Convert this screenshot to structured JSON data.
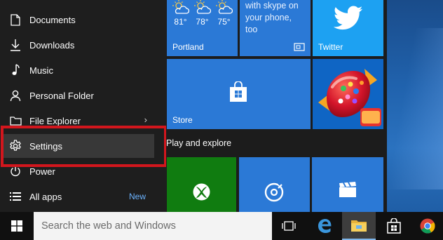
{
  "start_menu": {
    "items": [
      {
        "label": "Documents",
        "icon": "document-icon"
      },
      {
        "label": "Downloads",
        "icon": "download-icon"
      },
      {
        "label": "Music",
        "icon": "music-icon"
      },
      {
        "label": "Personal Folder",
        "icon": "person-icon"
      },
      {
        "label": "File Explorer",
        "icon": "folder-icon",
        "arrow": "›"
      },
      {
        "label": "Settings",
        "icon": "gear-icon",
        "selected": true
      },
      {
        "label": "Power",
        "icon": "power-icon"
      },
      {
        "label": "All apps",
        "icon": "list-icon",
        "badge": "New"
      }
    ]
  },
  "tiles": {
    "weather": {
      "label": "Portland",
      "temps": [
        "81°",
        "78°",
        "75°"
      ],
      "color": "#2b79d6"
    },
    "skype": {
      "text_lines": [
        "with skype on",
        "your phone,",
        "too"
      ],
      "color": "#2b79d6"
    },
    "twitter": {
      "label": "Twitter",
      "color": "#1da1f2"
    },
    "store": {
      "label": "Store",
      "color": "#2b79d6"
    },
    "candy_crush": {
      "color": "#0f65c4"
    },
    "section_title": "Play and explore",
    "xbox": {
      "color": "#107c10"
    },
    "groove": {
      "color": "#2b79d6"
    },
    "movies": {
      "color": "#2b79d6"
    }
  },
  "taskbar": {
    "search_placeholder": "Search the web and Windows",
    "apps": [
      "task-view-icon",
      "edge-icon",
      "file-explorer-icon",
      "store-icon",
      "chrome-icon"
    ]
  },
  "accent_colors": {
    "highlight_border": "#d2161d",
    "tile_blue": "#2b79d6",
    "new_badge": "#6cb4ff"
  }
}
